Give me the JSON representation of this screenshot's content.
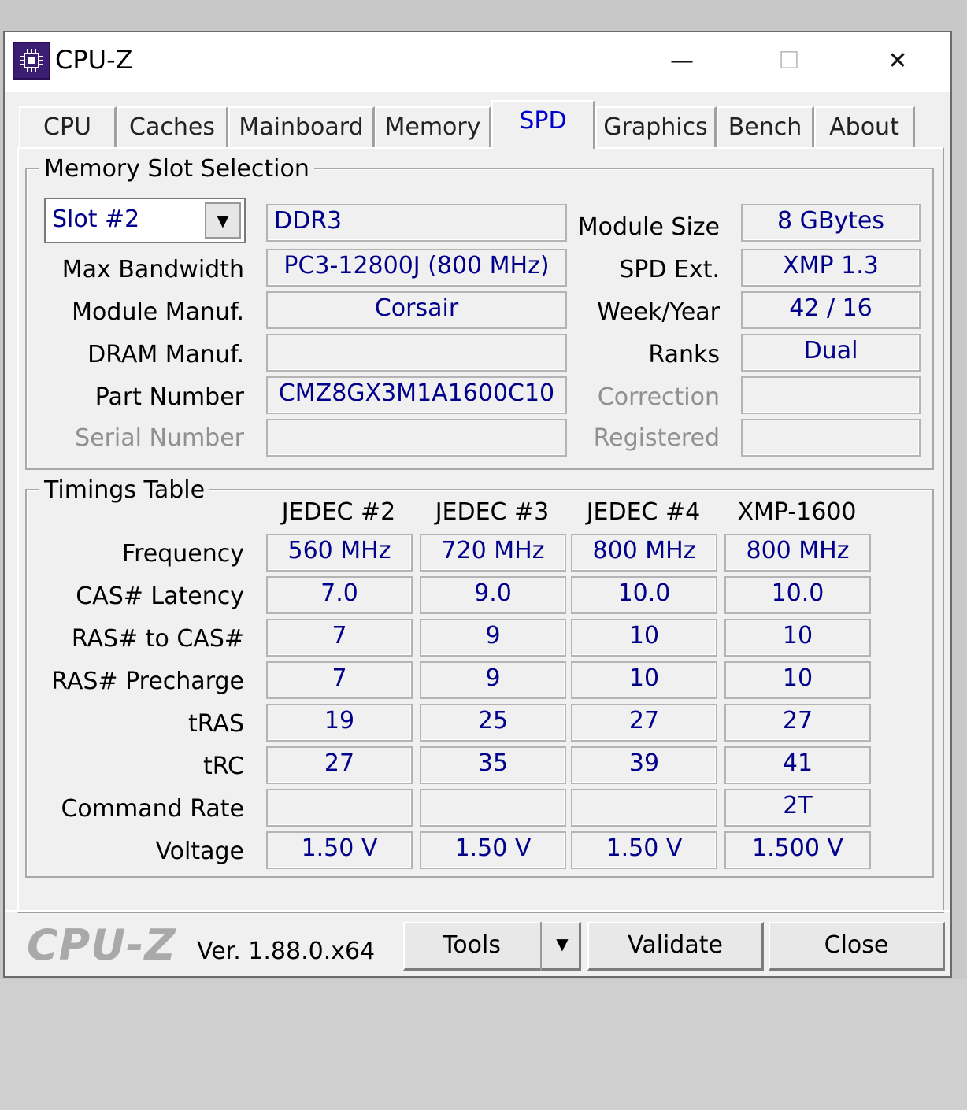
{
  "window": {
    "title": "CPU-Z",
    "minimize": "—",
    "maximize": "☐",
    "close": "✕"
  },
  "tabs": [
    "CPU",
    "Caches",
    "Mainboard",
    "Memory",
    "SPD",
    "Graphics",
    "Bench",
    "About"
  ],
  "active_tab": "SPD",
  "slot_group": {
    "title": "Memory Slot Selection",
    "slot_selected": "Slot #2",
    "memory_type": "DDR3",
    "labels": {
      "max_bandwidth": "Max Bandwidth",
      "module_manuf": "Module Manuf.",
      "dram_manuf": "DRAM Manuf.",
      "part_number": "Part Number",
      "serial_number": "Serial Number",
      "module_size": "Module Size",
      "spd_ext": "SPD Ext.",
      "week_year": "Week/Year",
      "ranks": "Ranks",
      "correction": "Correction",
      "registered": "Registered"
    },
    "values": {
      "max_bandwidth": "PC3-12800J (800 MHz)",
      "module_manuf": "Corsair",
      "dram_manuf": "",
      "part_number": "CMZ8GX3M1A1600C10",
      "serial_number": "",
      "module_size": "8 GBytes",
      "spd_ext": "XMP 1.3",
      "week_year": "42 / 16",
      "ranks": "Dual",
      "correction": "",
      "registered": ""
    }
  },
  "timings": {
    "title": "Timings Table",
    "columns": [
      "JEDEC #2",
      "JEDEC #3",
      "JEDEC #4",
      "XMP-1600"
    ],
    "rows": [
      {
        "label": "Frequency",
        "values": [
          "560 MHz",
          "720 MHz",
          "800 MHz",
          "800 MHz"
        ]
      },
      {
        "label": "CAS# Latency",
        "values": [
          "7.0",
          "9.0",
          "10.0",
          "10.0"
        ]
      },
      {
        "label": "RAS# to CAS#",
        "values": [
          "7",
          "9",
          "10",
          "10"
        ]
      },
      {
        "label": "RAS# Precharge",
        "values": [
          "7",
          "9",
          "10",
          "10"
        ]
      },
      {
        "label": "tRAS",
        "values": [
          "19",
          "25",
          "27",
          "27"
        ]
      },
      {
        "label": "tRC",
        "values": [
          "27",
          "35",
          "39",
          "41"
        ]
      },
      {
        "label": "Command Rate",
        "values": [
          "",
          "",
          "",
          "2T"
        ]
      },
      {
        "label": "Voltage",
        "values": [
          "1.50 V",
          "1.50 V",
          "1.50 V",
          "1.500 V"
        ]
      }
    ]
  },
  "footer": {
    "logo": "CPU-Z",
    "version": "Ver. 1.88.0.x64",
    "tools_label": "Tools",
    "validate_label": "Validate",
    "close_label": "Close"
  }
}
